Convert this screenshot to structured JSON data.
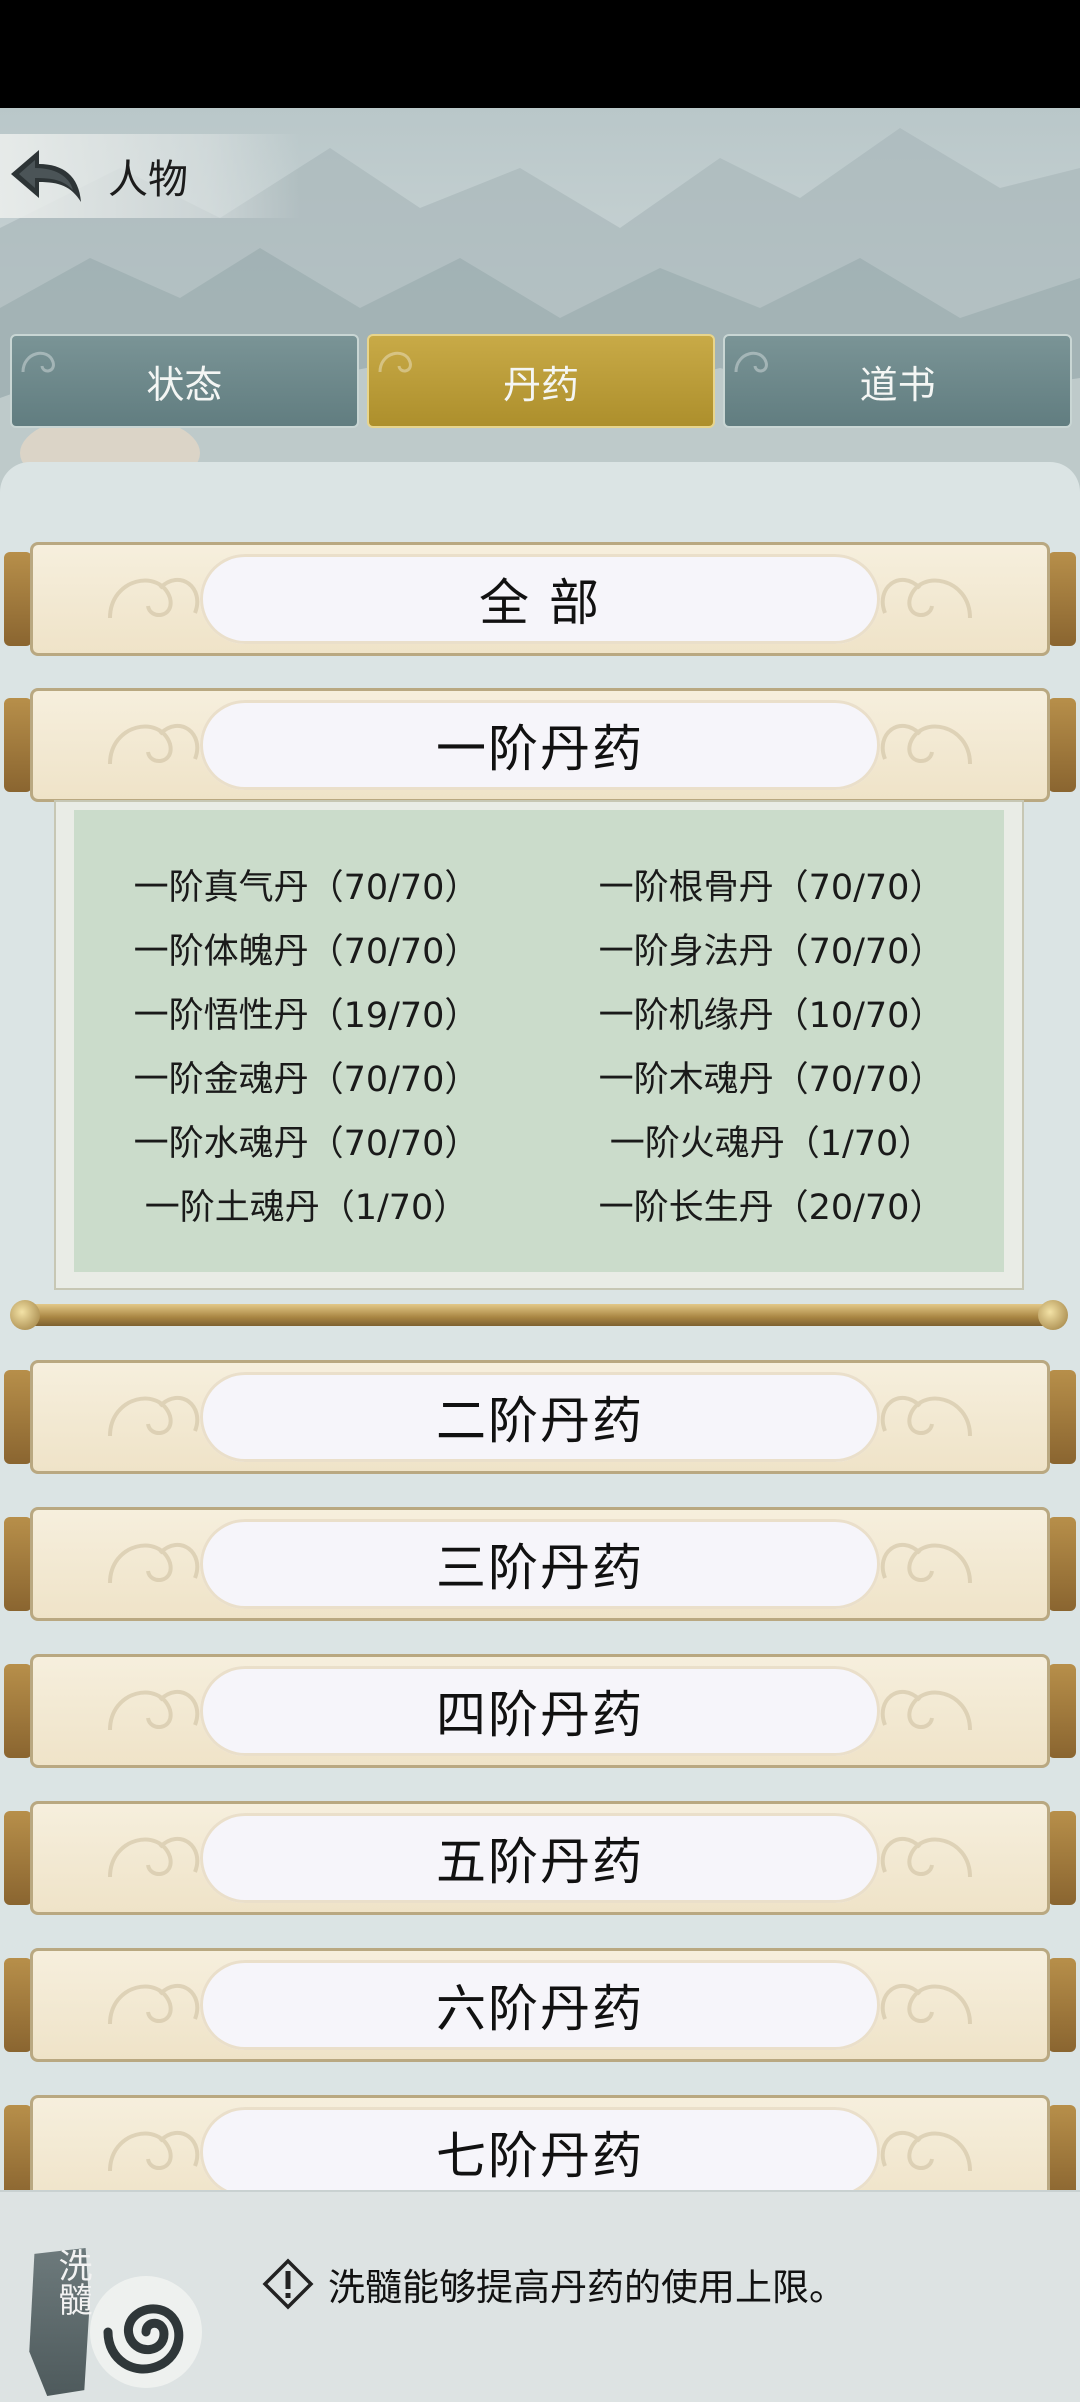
{
  "header": {
    "title": "人物"
  },
  "tabs": [
    {
      "label": "状态",
      "active": false
    },
    {
      "label": "丹药",
      "active": true
    },
    {
      "label": "道书",
      "active": false
    }
  ],
  "categories": [
    {
      "label": "全 部"
    },
    {
      "label": "一阶丹药"
    },
    {
      "label": "二阶丹药"
    },
    {
      "label": "三阶丹药"
    },
    {
      "label": "四阶丹药"
    },
    {
      "label": "五阶丹药"
    },
    {
      "label": "六阶丹药"
    },
    {
      "label": "七阶丹药"
    }
  ],
  "tier1_pills": [
    [
      "一阶真气丹（70/70）",
      "一阶根骨丹（70/70）"
    ],
    [
      "一阶体魄丹（70/70）",
      "一阶身法丹（70/70）"
    ],
    [
      "一阶悟性丹（19/70）",
      "一阶机缘丹（10/70）"
    ],
    [
      "一阶金魂丹（70/70）",
      "一阶木魂丹（70/70）"
    ],
    [
      "一阶水魂丹（70/70）",
      "一阶火魂丹（1/70）"
    ],
    [
      "一阶土魂丹（1/70）",
      "一阶长生丹（20/70）"
    ]
  ],
  "footer": {
    "xisui_label": "洗髓",
    "hint": "洗髓能够提高丹药的使用上限。"
  },
  "colors": {
    "tab_active": "#b8992f",
    "tab_inactive": "#6b878a",
    "scroll_paper": "#f3e9d2",
    "expanded_bg": "#cbdccb"
  }
}
